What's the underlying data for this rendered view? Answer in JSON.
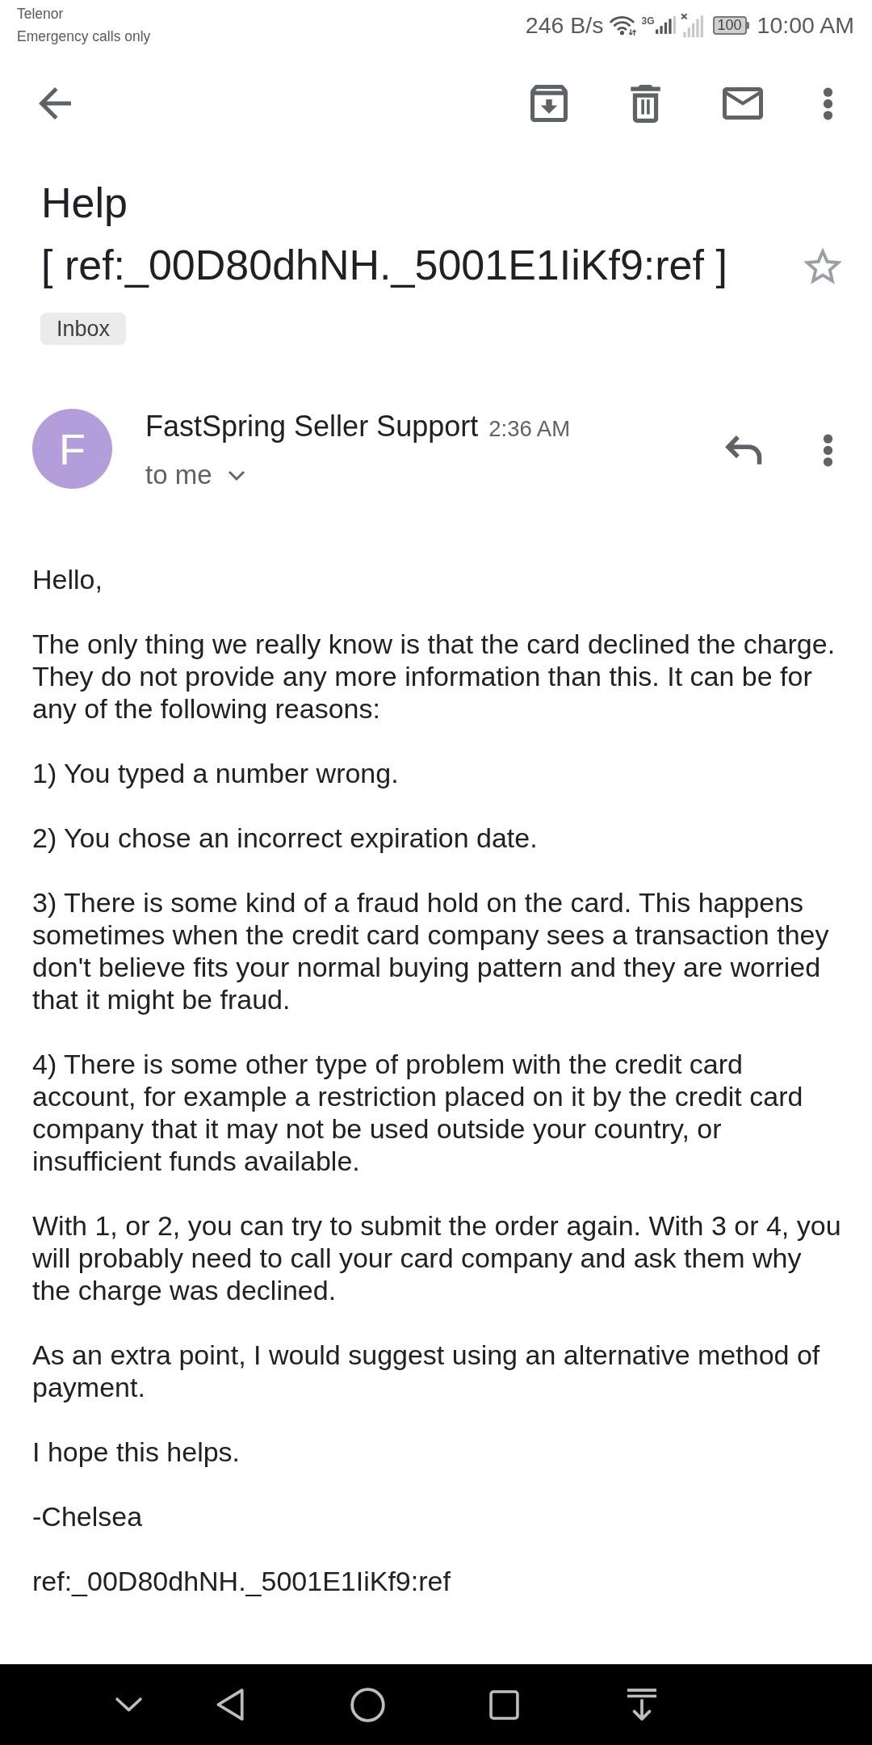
{
  "status_bar": {
    "carrier": "Telenor",
    "network_status": "Emergency calls only",
    "data_rate": "246 B/s",
    "network_type": "3G",
    "battery": "100",
    "time": "10:00 AM"
  },
  "message": {
    "subject": "Help\n[ ref:_00D80dhNH._5001E1IiKf9:ref ]",
    "starred": false,
    "labels": [
      "Inbox"
    ]
  },
  "sender": {
    "initial": "F",
    "name": "FastSpring Seller Support",
    "time": "2:36 AM",
    "recipient": "to me"
  },
  "body": [
    "Hello,",
    "The only thing we really know is that the card declined the charge. They do not provide any more information than this. It can be for any of the following reasons:",
    "1) You typed a number wrong.",
    "2) You chose an incorrect expiration date.",
    "3) There is some kind of a fraud hold on the card. This happens sometimes when the credit card company sees a transaction they don't believe fits your normal buying pattern and they are worried that it might be fraud.",
    "4) There is some other type of problem with the credit card account, for example a restriction placed on it by the credit card company that it may not be used outside your country, or insufficient funds available.",
    "With 1, or 2, you can try to submit the order again. With 3 or 4, you will probably need to call your card company and ask them why the charge was declined.",
    "As an extra point, I would suggest using an alternative method of payment.",
    "I hope this helps.",
    "-Chelsea",
    "ref:_00D80dhNH._5001E1IiKf9:ref"
  ]
}
